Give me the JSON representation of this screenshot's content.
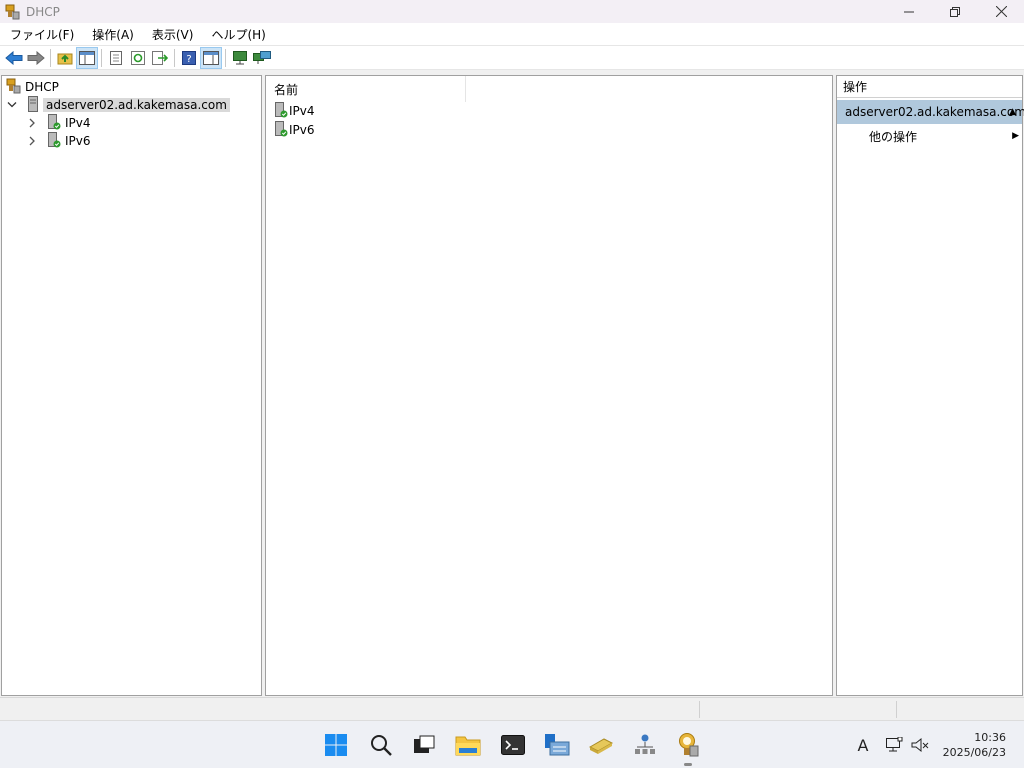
{
  "window": {
    "title": "DHCP"
  },
  "menu": [
    "ファイル(F)",
    "操作(A)",
    "表示(V)",
    "ヘルプ(H)"
  ],
  "tree": {
    "root": "DHCP",
    "server": "adserver02.ad.kakemasa.com",
    "children": [
      "IPv4",
      "IPv6"
    ]
  },
  "list": {
    "column": "名前",
    "items": [
      "IPv4",
      "IPv6"
    ]
  },
  "actions": {
    "header": "操作",
    "selected": "adserver02.ad.kakemasa.com",
    "more": "他の操作"
  },
  "taskbar": {
    "ime": "A",
    "time": "10:36",
    "date": "2025/06/23"
  },
  "colors": {
    "selection": "#b0c8dc",
    "accent": "#0078d4"
  }
}
